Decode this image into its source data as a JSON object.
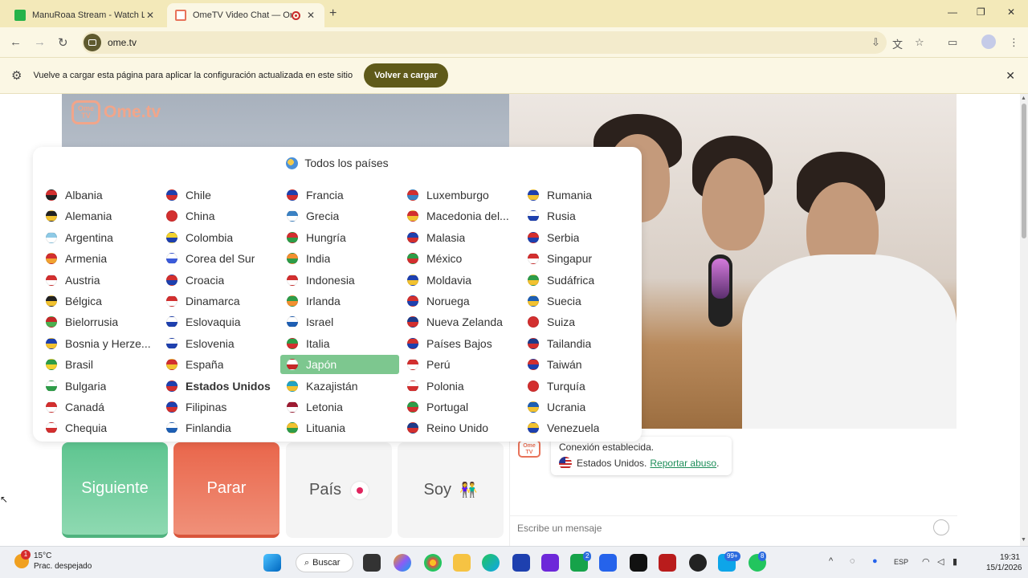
{
  "browser": {
    "tabs": [
      {
        "title": "ManuRoaa Stream - Watch Live",
        "close": "✕"
      },
      {
        "title": "OmeTV Video Chat — Ome",
        "close": "✕"
      }
    ],
    "new_tab": "+",
    "url": "ome.tv",
    "infobar": {
      "text": "Vuelve a cargar esta página para aplicar la configuración actualizada en este sitio",
      "button": "Volver a cargar"
    }
  },
  "logo": {
    "badge": "Ome TV",
    "text": "Ome.tv"
  },
  "country_panel": {
    "header": "Todos los países",
    "columns": [
      [
        {
          "name": "Albania",
          "c1": "#d32f2f",
          "c2": "#222222"
        },
        {
          "name": "Alemania",
          "c1": "#222222",
          "c2": "#f2c230"
        },
        {
          "name": "Argentina",
          "c1": "#8ecae6",
          "c2": "#ffffff"
        },
        {
          "name": "Armenia",
          "c1": "#d32f2f",
          "c2": "#f2a230"
        },
        {
          "name": "Austria",
          "c1": "#d32f2f",
          "c2": "#ffffff"
        },
        {
          "name": "Bélgica",
          "c1": "#222222",
          "c2": "#f2c230"
        },
        {
          "name": "Bielorrusia",
          "c1": "#c62828",
          "c2": "#4caf50"
        },
        {
          "name": "Bosnia y Herze...",
          "c1": "#1e40af",
          "c2": "#f2c230"
        },
        {
          "name": "Brasil",
          "c1": "#2e9d48",
          "c2": "#f2d230"
        },
        {
          "name": "Bulgaria",
          "c1": "#ffffff",
          "c2": "#2e9d48"
        },
        {
          "name": "Canadá",
          "c1": "#d32f2f",
          "c2": "#ffffff"
        },
        {
          "name": "Chequia",
          "c1": "#ffffff",
          "c2": "#d32f2f"
        }
      ],
      [
        {
          "name": "Chile",
          "c1": "#1e40af",
          "c2": "#d32f2f"
        },
        {
          "name": "China",
          "c1": "#d32f2f",
          "c2": "#d32f2f"
        },
        {
          "name": "Colombia",
          "c1": "#f2d230",
          "c2": "#1e40af"
        },
        {
          "name": "Corea del Sur",
          "c1": "#ffffff",
          "c2": "#3b5bdb"
        },
        {
          "name": "Croacia",
          "c1": "#d32f2f",
          "c2": "#1e40af"
        },
        {
          "name": "Dinamarca",
          "c1": "#d32f2f",
          "c2": "#ffffff"
        },
        {
          "name": "Eslovaquia",
          "c1": "#ffffff",
          "c2": "#1e40af"
        },
        {
          "name": "Eslovenia",
          "c1": "#ffffff",
          "c2": "#1e40af"
        },
        {
          "name": "España",
          "c1": "#d32f2f",
          "c2": "#f2c230"
        },
        {
          "name": "Estados Unidos",
          "c1": "#1e40af",
          "c2": "#d32f2f",
          "bold": true
        },
        {
          "name": "Filipinas",
          "c1": "#1e40af",
          "c2": "#d32f2f"
        },
        {
          "name": "Finlandia",
          "c1": "#ffffff",
          "c2": "#1e5fb4"
        }
      ],
      [
        {
          "name": "Francia",
          "c1": "#1e40af",
          "c2": "#d32f2f"
        },
        {
          "name": "Grecia",
          "c1": "#3b82c4",
          "c2": "#ffffff"
        },
        {
          "name": "Hungría",
          "c1": "#d32f2f",
          "c2": "#2e9d48"
        },
        {
          "name": "India",
          "c1": "#f29030",
          "c2": "#2e9d48"
        },
        {
          "name": "Indonesia",
          "c1": "#d32f2f",
          "c2": "#ffffff"
        },
        {
          "name": "Irlanda",
          "c1": "#2e9d48",
          "c2": "#f29030"
        },
        {
          "name": "Israel",
          "c1": "#ffffff",
          "c2": "#1e5fb4"
        },
        {
          "name": "Italia",
          "c1": "#2e9d48",
          "c2": "#d32f2f"
        },
        {
          "name": "Japón",
          "c1": "#ffffff",
          "c2": "#c62828",
          "selected": true
        },
        {
          "name": "Kazajistán",
          "c1": "#22a3c4",
          "c2": "#f2c230"
        },
        {
          "name": "Letonia",
          "c1": "#9e1b32",
          "c2": "#ffffff"
        },
        {
          "name": "Lituania",
          "c1": "#f2c230",
          "c2": "#2e9d48"
        }
      ],
      [
        {
          "name": "Luxemburgo",
          "c1": "#d32f2f",
          "c2": "#3b82c4"
        },
        {
          "name": "Macedonia del...",
          "c1": "#d32f2f",
          "c2": "#f2c230"
        },
        {
          "name": "Malasia",
          "c1": "#1e40af",
          "c2": "#d32f2f"
        },
        {
          "name": "México",
          "c1": "#2e9d48",
          "c2": "#d32f2f"
        },
        {
          "name": "Moldavia",
          "c1": "#1e40af",
          "c2": "#f2c230"
        },
        {
          "name": "Noruega",
          "c1": "#d32f2f",
          "c2": "#1e40af"
        },
        {
          "name": "Nueva Zelanda",
          "c1": "#1e3a8a",
          "c2": "#d32f2f"
        },
        {
          "name": "Países Bajos",
          "c1": "#d32f2f",
          "c2": "#1e40af"
        },
        {
          "name": "Perú",
          "c1": "#d32f2f",
          "c2": "#ffffff"
        },
        {
          "name": "Polonia",
          "c1": "#ffffff",
          "c2": "#d32f2f"
        },
        {
          "name": "Portugal",
          "c1": "#2e9d48",
          "c2": "#d32f2f"
        },
        {
          "name": "Reino Unido",
          "c1": "#1e3a8a",
          "c2": "#d32f2f"
        }
      ],
      [
        {
          "name": "Rumania",
          "c1": "#1e40af",
          "c2": "#f2c230"
        },
        {
          "name": "Rusia",
          "c1": "#ffffff",
          "c2": "#1e40af"
        },
        {
          "name": "Serbia",
          "c1": "#d32f2f",
          "c2": "#1e40af"
        },
        {
          "name": "Singapur",
          "c1": "#d32f2f",
          "c2": "#ffffff"
        },
        {
          "name": "Sudáfrica",
          "c1": "#2e9d48",
          "c2": "#f2c230"
        },
        {
          "name": "Suecia",
          "c1": "#1e5fb4",
          "c2": "#f2c230"
        },
        {
          "name": "Suiza",
          "c1": "#d32f2f",
          "c2": "#d32f2f"
        },
        {
          "name": "Tailandia",
          "c1": "#1e3a8a",
          "c2": "#d32f2f"
        },
        {
          "name": "Taiwán",
          "c1": "#d32f2f",
          "c2": "#1e40af"
        },
        {
          "name": "Turquía",
          "c1": "#d32f2f",
          "c2": "#d32f2f"
        },
        {
          "name": "Ucrania",
          "c1": "#1e5fb4",
          "c2": "#f2c230"
        },
        {
          "name": "Venezuela",
          "c1": "#f2c230",
          "c2": "#1e40af"
        }
      ]
    ]
  },
  "controls": {
    "next": "Siguiente",
    "stop": "Parar",
    "country": "País",
    "gender": "Soy",
    "gender_icon": "👫"
  },
  "chat": {
    "logo_badge": "Ome TV",
    "status": "Conexión establecida.",
    "country": "Estados Unidos.",
    "report": "Reportar abuso",
    "report_suffix": ".",
    "input_placeholder": "Escribe un mensaje"
  },
  "taskbar": {
    "weather_temp": "15°C",
    "weather_desc": "Prac. despejado",
    "weather_badge": "1",
    "search": "Buscar",
    "badges": [
      "2",
      "99+",
      "8"
    ],
    "lang": "ESP",
    "time": "19:31",
    "date": "15/1/2026"
  },
  "colors": {
    "next_green": "#5ec590",
    "stop_red": "#e9664b",
    "selected_green": "#7dc78f",
    "link_green": "#1e8e5a",
    "reload_btn": "#5f5a19"
  }
}
